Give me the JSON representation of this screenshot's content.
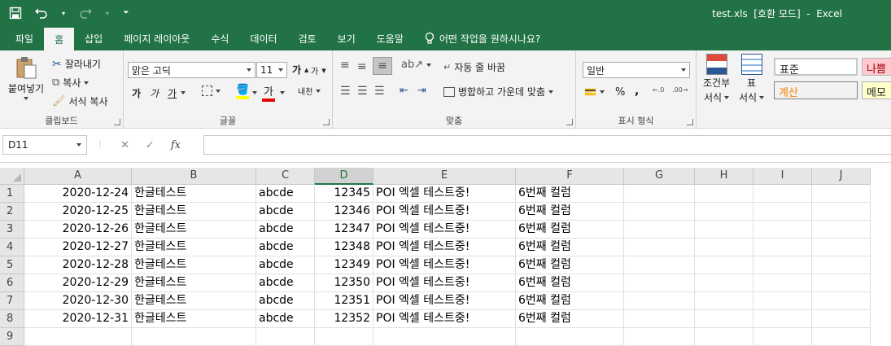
{
  "window": {
    "title": "test.xls  [호환 모드]  -  Excel"
  },
  "tabs": [
    "파일",
    "홈",
    "삽입",
    "페이지 레이아웃",
    "수식",
    "데이터",
    "검토",
    "보기",
    "도움말"
  ],
  "tell_me": "어떤 작업을 원하시나요?",
  "ribbon": {
    "clipboard": {
      "paste": "붙여넣기",
      "cut": "잘라내기",
      "copy": "복사",
      "format_painter": "서식 복사",
      "label": "클립보드"
    },
    "font": {
      "name": "맑은 고딕",
      "size": "11",
      "label": "글꼴",
      "bold": "가",
      "italic": "가",
      "underline": "가",
      "phonetic": "내천"
    },
    "alignment": {
      "wrap": "자동 줄 바꿈",
      "merge": "병합하고 가운데 맞춤",
      "label": "맞춤"
    },
    "number": {
      "format": "일반",
      "label": "표시 형식",
      "percent": "%",
      "comma": ","
    },
    "styles": {
      "conditional": "조건부",
      "conditional2": "서식",
      "table": "표",
      "table2": "서식",
      "normal": "표준",
      "bad": "나쁨",
      "calc": "계산",
      "memo": "메모"
    }
  },
  "formula_bar": {
    "name_box": "D11",
    "fx": "fx"
  },
  "grid": {
    "columns": [
      "A",
      "B",
      "C",
      "D",
      "E",
      "F",
      "G",
      "H",
      "I",
      "J"
    ],
    "selected_column": "D",
    "row_numbers": [
      "1",
      "2",
      "3",
      "4",
      "5",
      "6",
      "7",
      "8",
      "9"
    ],
    "rows": [
      [
        "2020-12-24",
        "한글테스트",
        "abcde",
        "12345",
        "POI 엑셀 테스트중!",
        "6번째 컬럼"
      ],
      [
        "2020-12-25",
        "한글테스트",
        "abcde",
        "12346",
        "POI 엑셀 테스트중!",
        "6번째 컬럼"
      ],
      [
        "2020-12-26",
        "한글테스트",
        "abcde",
        "12347",
        "POI 엑셀 테스트중!",
        "6번째 컬럼"
      ],
      [
        "2020-12-27",
        "한글테스트",
        "abcde",
        "12348",
        "POI 엑셀 테스트중!",
        "6번째 컬럼"
      ],
      [
        "2020-12-28",
        "한글테스트",
        "abcde",
        "12349",
        "POI 엑셀 테스트중!",
        "6번째 컬럼"
      ],
      [
        "2020-12-29",
        "한글테스트",
        "abcde",
        "12350",
        "POI 엑셀 테스트중!",
        "6번째 컬럼"
      ],
      [
        "2020-12-30",
        "한글테스트",
        "abcde",
        "12351",
        "POI 엑셀 테스트중!",
        "6번째 컬럼"
      ],
      [
        "2020-12-31",
        "한글테스트",
        "abcde",
        "12352",
        "POI 엑셀 테스트중!",
        "6번째 컬럼"
      ]
    ]
  },
  "colors": {
    "accent": "#217346",
    "bad_fill": "#ffc7ce",
    "bad_text": "#9c0006",
    "calc_text": "#fa7d00",
    "memo_fill": "#ffffcc"
  }
}
